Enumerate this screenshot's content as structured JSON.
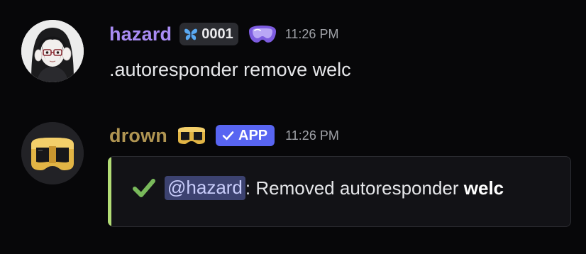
{
  "messages": [
    {
      "author": "hazard",
      "guild_tag": "0001",
      "timestamp": "11:26 PM",
      "content": ".autoresponder remove welc",
      "avatar_icon": "anime-girl-avatar-icon",
      "tag_icon": "butterfly-icon",
      "role_icon": "goggles-icon",
      "name_color": "#a98cf3"
    },
    {
      "author": "drown",
      "app_badge": "APP",
      "timestamp": "11:26 PM",
      "avatar_icon": "gold-diving-mask-icon",
      "role_icon": "gold-diving-mask-icon",
      "name_color": "#b09552",
      "embed": {
        "accent_color": "#b2dc75",
        "icon": "checkmark-icon",
        "mention": "@hazard",
        "separator": ":",
        "text": " Removed autoresponder ",
        "strong": "welc"
      }
    }
  ]
}
